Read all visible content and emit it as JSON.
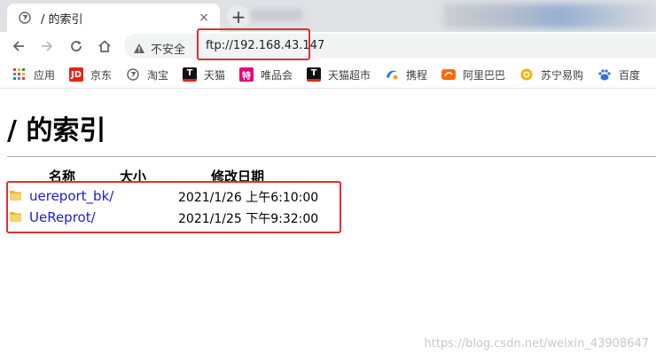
{
  "tab": {
    "title": "/ 的索引",
    "close_glyph": "×"
  },
  "new_tab_glyph": "+",
  "address_bar": {
    "security_label": "不安全",
    "url": "ftp://192.168.43.147"
  },
  "bookmarks": [
    {
      "label": "应用",
      "icon": "apps-grid-icon"
    },
    {
      "label": "京东",
      "icon": "jd-icon",
      "badge": "JD",
      "color": "#e1251b"
    },
    {
      "label": "淘宝",
      "icon": "globe-icon"
    },
    {
      "label": "天猫",
      "icon": "tmall-icon",
      "badge": "T",
      "color": "#111111"
    },
    {
      "label": "唯品会",
      "icon": "vip-icon",
      "badge": "特",
      "color": "#e4007f"
    },
    {
      "label": "天猫超市",
      "icon": "tmall-market-icon",
      "badge": "T",
      "color": "#111111"
    },
    {
      "label": "携程",
      "icon": "ctrip-icon"
    },
    {
      "label": "阿里巴巴",
      "icon": "alibaba-icon"
    },
    {
      "label": "苏宁易购",
      "icon": "suning-icon"
    },
    {
      "label": "百度",
      "icon": "baidu-icon"
    }
  ],
  "page": {
    "title": "/ 的索引",
    "columns": [
      "名称",
      "大小",
      "修改日期"
    ],
    "rows": [
      {
        "name": "uereport_bk/",
        "size": "",
        "date": "2021/1/26 上午6:10:00"
      },
      {
        "name": "UeReprot/",
        "size": "",
        "date": "2021/1/25 下午9:32:00"
      }
    ]
  },
  "watermark": "https://blog.csdn.net/weixin_43908647"
}
